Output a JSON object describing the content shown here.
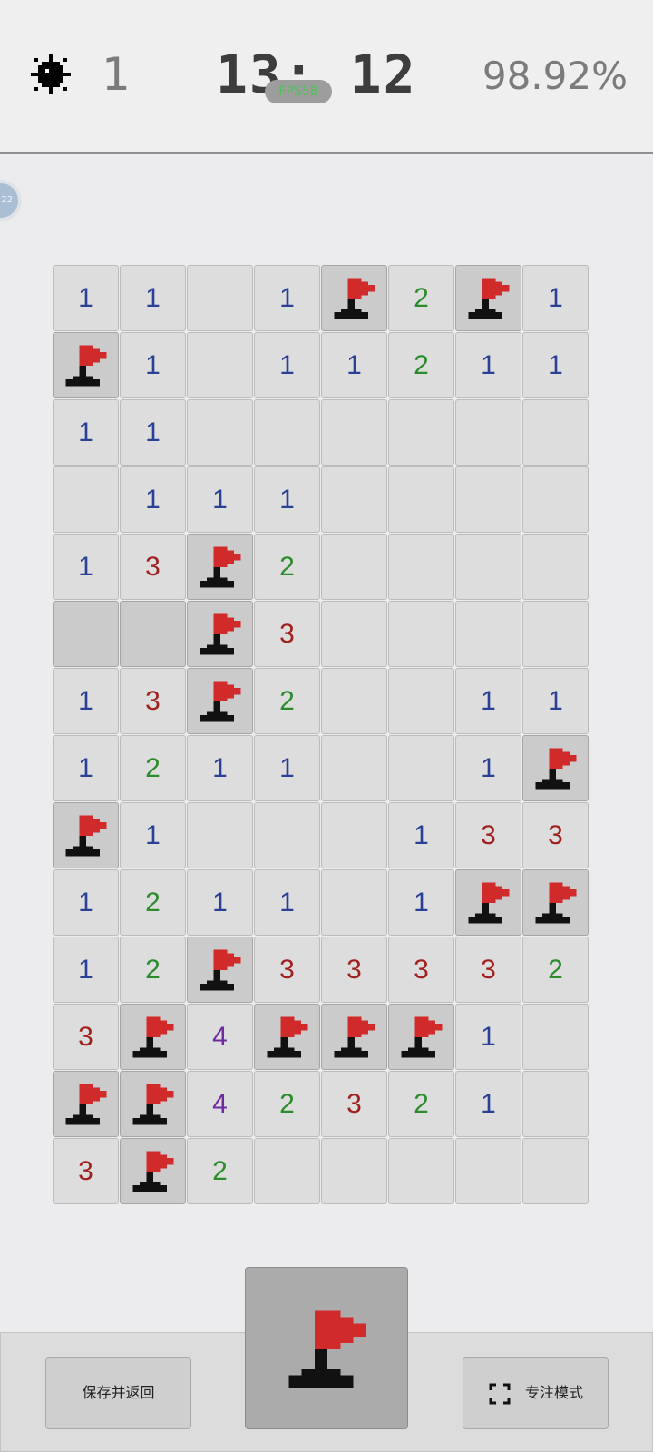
{
  "header": {
    "mines_remaining": "1",
    "timer": "13: 12",
    "fps": "FPS58",
    "progress": "98.92%"
  },
  "side_bubble": "22",
  "board": {
    "cols": 8,
    "rows": [
      [
        "1",
        "1",
        "",
        "1",
        "F",
        "2",
        "F",
        "1"
      ],
      [
        "F",
        "1",
        "",
        "1",
        "1",
        "2",
        "1",
        "1"
      ],
      [
        "1",
        "1",
        "",
        "",
        "",
        "",
        "",
        ""
      ],
      [
        "",
        "1",
        "1",
        "1",
        "",
        "",
        "",
        ""
      ],
      [
        "1",
        "3",
        "F",
        "2",
        "",
        "",
        "",
        ""
      ],
      [
        "H",
        "H",
        "F",
        "3",
        "",
        "",
        "",
        ""
      ],
      [
        "1",
        "3",
        "F",
        "2",
        "",
        "",
        "1",
        "1"
      ],
      [
        "1",
        "2",
        "1",
        "1",
        "",
        "",
        "1",
        "F"
      ],
      [
        "F",
        "1",
        "",
        "",
        "",
        "1",
        "3",
        "3"
      ],
      [
        "1",
        "2",
        "1",
        "1",
        "",
        "1",
        "F",
        "F"
      ],
      [
        "1",
        "2",
        "F",
        "3",
        "3",
        "3",
        "3",
        "2"
      ],
      [
        "3",
        "F",
        "4",
        "F",
        "F",
        "F",
        "1",
        ""
      ],
      [
        "F",
        "F",
        "4",
        "2",
        "3",
        "2",
        "1",
        ""
      ],
      [
        "3",
        "F",
        "2",
        "",
        "",
        "",
        "",
        ""
      ]
    ]
  },
  "footer": {
    "save_label": "保存并返回",
    "focus_label": "专注模式",
    "mode_icon": "flag-icon"
  },
  "colors": {
    "n1": "#2a3f96",
    "n2": "#2b8c2b",
    "n3": "#a02020",
    "n4": "#6b2aa0",
    "flag_red": "#d02a2a",
    "flag_base": "#111111"
  }
}
